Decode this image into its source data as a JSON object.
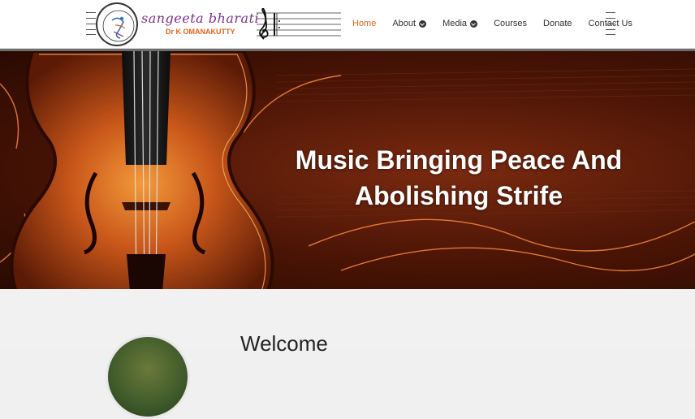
{
  "brand": {
    "name": "sangeeta bharati",
    "subtitle": "Dr K OMANAKUTTY"
  },
  "nav": {
    "items": [
      {
        "label": "Home",
        "active": true,
        "has_dropdown": false
      },
      {
        "label": "About",
        "active": false,
        "has_dropdown": true
      },
      {
        "label": "Media",
        "active": false,
        "has_dropdown": true
      },
      {
        "label": "Courses",
        "active": false,
        "has_dropdown": false
      },
      {
        "label": "Donate",
        "active": false,
        "has_dropdown": false
      },
      {
        "label": "Contact Us",
        "active": false,
        "has_dropdown": false
      }
    ]
  },
  "hero": {
    "title_line1": "Music Bringing Peace And",
    "title_line2": "Abolishing Strife",
    "image": "violin-on-sheet-music"
  },
  "welcome": {
    "heading": "Welcome"
  },
  "colors": {
    "accent": "#e0641c",
    "brand_purple": "#7b2f8e",
    "hero_bg": "#4a1405",
    "text": "#333333"
  },
  "icons": [
    "music-staff-icon",
    "treble-clef-icon",
    "chevron-down-icon",
    "logo-seal"
  ]
}
